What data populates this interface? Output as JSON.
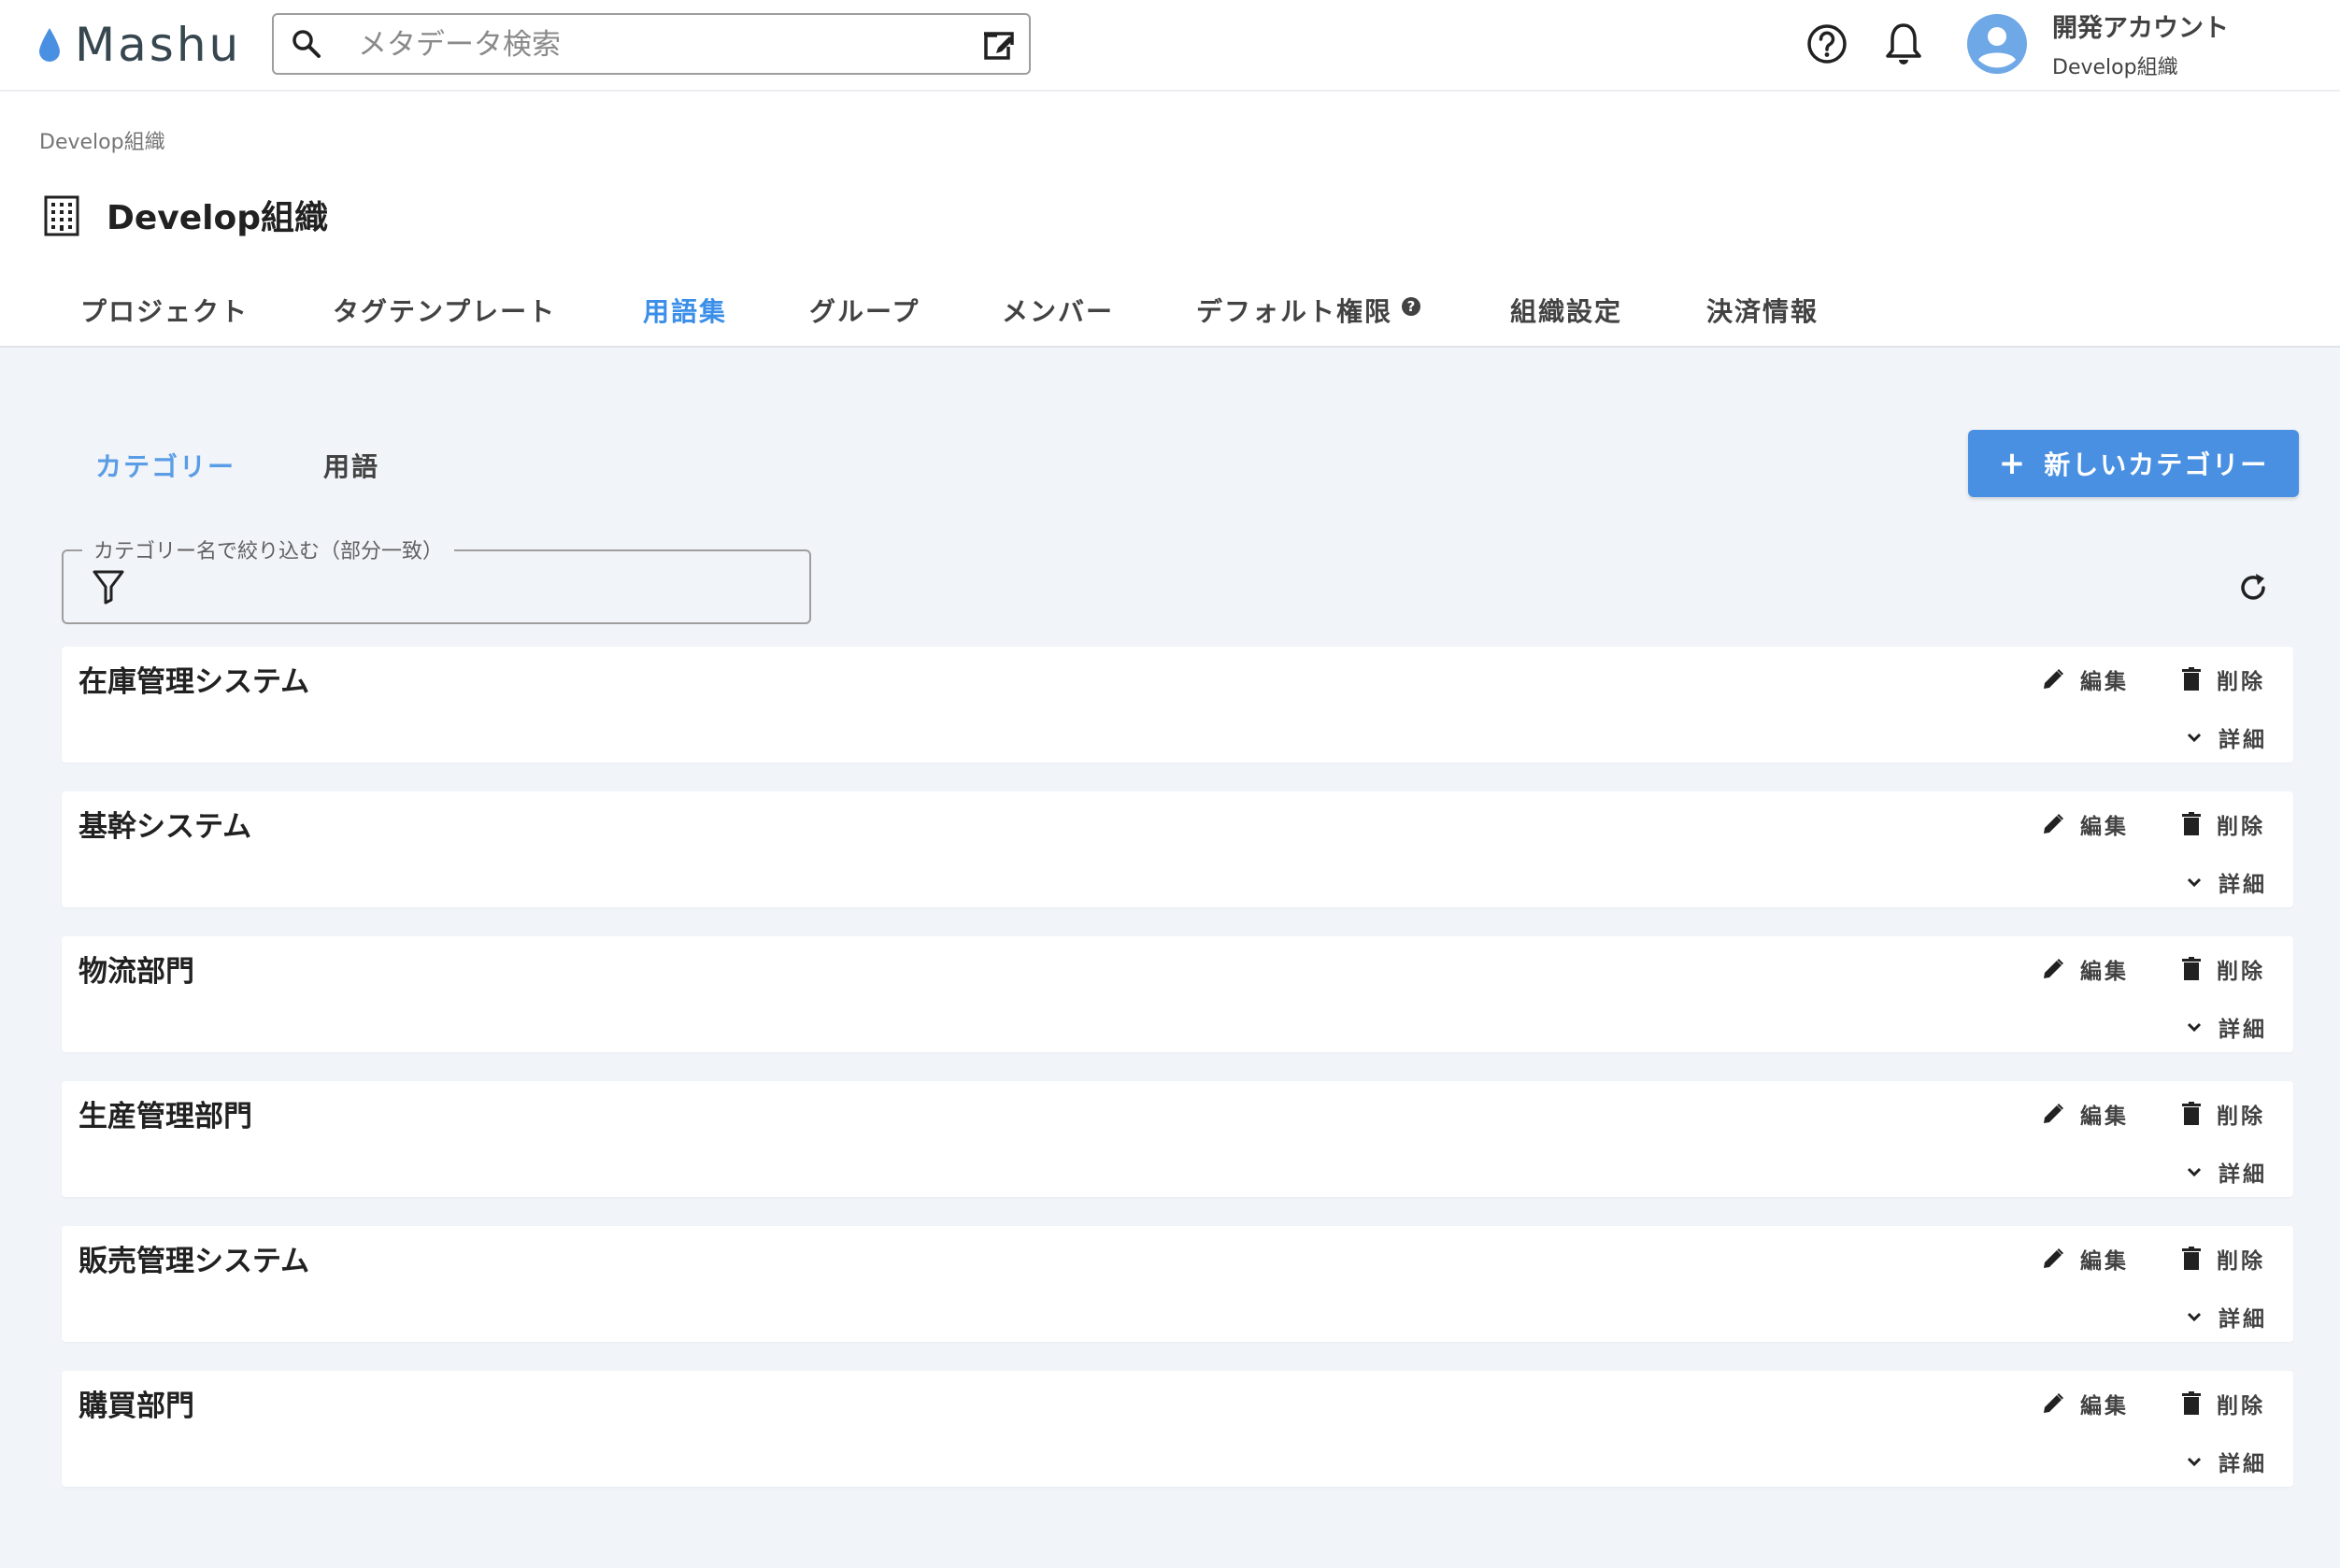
{
  "header": {
    "logo": "Mashu",
    "search_placeholder": "メタデータ検索",
    "account_name": "開発アカウント",
    "account_org": "Develop組織"
  },
  "breadcrumb": "Develop組織",
  "page_title": "Develop組織",
  "nav_tabs": [
    {
      "label": "プロジェクト",
      "active": false
    },
    {
      "label": "タグテンプレート",
      "active": false
    },
    {
      "label": "用語集",
      "active": true
    },
    {
      "label": "グループ",
      "active": false
    },
    {
      "label": "メンバー",
      "active": false
    },
    {
      "label": "デフォルト権限",
      "active": false,
      "info_badge": "?"
    },
    {
      "label": "組織設定",
      "active": false
    },
    {
      "label": "決済情報",
      "active": false
    }
  ],
  "sub_tabs": [
    {
      "label": "カテゴリー",
      "active": true
    },
    {
      "label": "用語",
      "active": false
    }
  ],
  "new_button": {
    "plus": "+",
    "label": "新しいカテゴリー"
  },
  "filter": {
    "label": "カテゴリー名で絞り込む（部分一致）",
    "value": ""
  },
  "actions": {
    "edit": "編集",
    "delete": "削除",
    "detail": "詳細"
  },
  "categories": [
    {
      "name": "在庫管理システム"
    },
    {
      "name": "基幹システム"
    },
    {
      "name": "物流部門"
    },
    {
      "name": "生産管理部門"
    },
    {
      "name": "販売管理システム"
    },
    {
      "name": "購買部門"
    }
  ],
  "colors": {
    "accent": "#4a90e2",
    "active_tab": "#3b8fe8",
    "background": "#f1f4f9",
    "text": "#212121",
    "logo_drop": "#4a90e2"
  },
  "icons": [
    "water-drop-icon",
    "search-icon",
    "edit-square-icon",
    "help-circle-icon",
    "bell-icon",
    "account-circle-icon",
    "building-icon",
    "info-badge-icon",
    "plus-icon",
    "filter-icon",
    "refresh-icon",
    "pencil-icon",
    "trash-icon",
    "chevron-down-icon"
  ]
}
